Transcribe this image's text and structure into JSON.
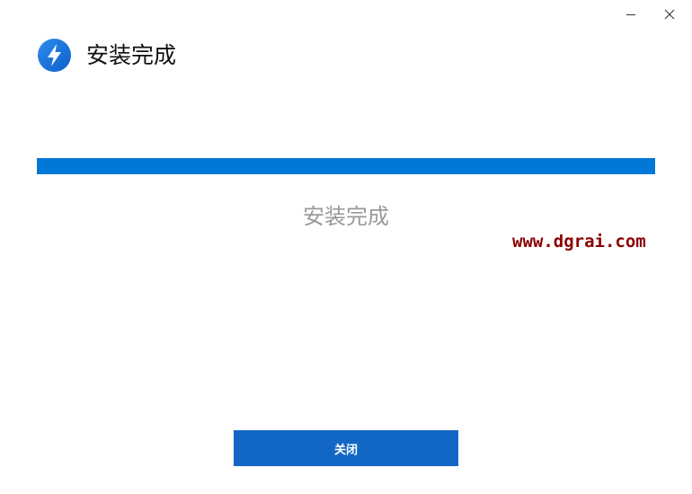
{
  "window": {
    "controls": {
      "minimize_icon": "minimize-icon",
      "close_icon": "close-icon"
    }
  },
  "header": {
    "logo_icon": "lightning-bolt-icon",
    "title": "安装完成"
  },
  "progress": {
    "fraction": 1.0,
    "color": "#0078d7"
  },
  "status": {
    "text": "安装完成"
  },
  "watermark": {
    "text": "www.dgrai.com",
    "color": "#8b0000"
  },
  "footer": {
    "close_label": "关闭",
    "button_color": "#1367c4"
  }
}
